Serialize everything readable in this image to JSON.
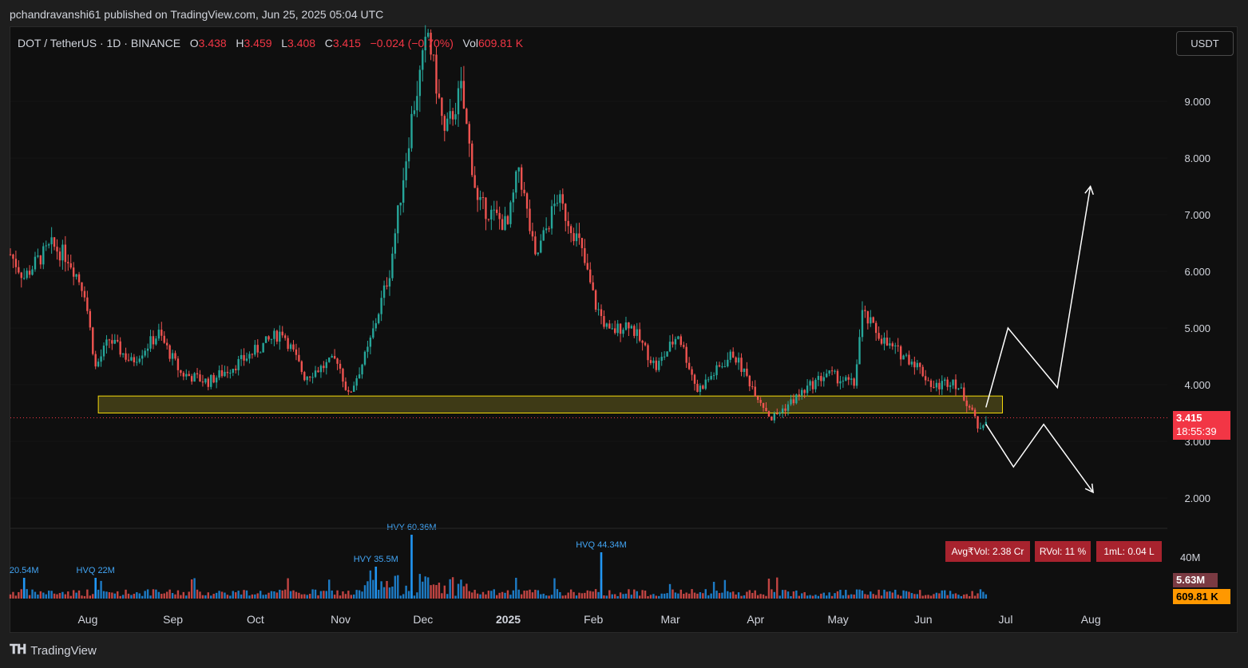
{
  "header": {
    "published": "pchandravanshi61 published on TradingView.com, Jun 25, 2025 05:04 UTC"
  },
  "legend": {
    "symbol": "DOT / TetherUS · 1D · BINANCE",
    "o_label": "O",
    "o": "3.438",
    "h_label": "H",
    "h": "3.459",
    "l_label": "L",
    "l": "3.408",
    "c_label": "C",
    "c": "3.415",
    "change": "−0.024 (−0.70%)",
    "vol_label": "Vol",
    "vol": "609.81 K"
  },
  "currency_button": "USDT",
  "price_tag": {
    "price": "3.415",
    "countdown": "18:55:39",
    "value": 3.415
  },
  "volume_tags": {
    "ma": "5.63M",
    "vol": "609.81 K",
    "scale": "40M"
  },
  "stats": {
    "avg": "Avg₹Vol: 2.38 Cr",
    "rvol": "RVol: 11 %",
    "ml": "1mL: 0.04 L"
  },
  "footer": {
    "brand": "TradingView"
  },
  "colors": {
    "up": "#26a69a",
    "down": "#ef5350",
    "zone": "#f5d90a",
    "tag": "#f23645",
    "vol_tag": "#ff9800"
  },
  "chart_data": {
    "type": "candlestick",
    "yaxis": {
      "ticks": [
        2,
        3,
        4,
        5,
        6,
        7,
        8,
        9
      ],
      "tick_labels": [
        "2.000",
        "3.000",
        "4.000",
        "5.000",
        "6.000",
        "7.000",
        "8.000",
        "9.000"
      ],
      "ylim": [
        1.5,
        10.3
      ]
    },
    "xaxis": {
      "labels": [
        "Aug",
        "Sep",
        "Oct",
        "Nov",
        "Dec",
        "2025",
        "Feb",
        "Mar",
        "Apr",
        "May",
        "Jun",
        "Jul",
        "Aug"
      ],
      "dates": [
        "2024-08-01",
        "2024-09-01",
        "2024-10-01",
        "2024-11-01",
        "2024-12-01",
        "2025-01-01",
        "2025-02-01",
        "2025-03-01",
        "2025-04-01",
        "2025-05-01",
        "2025-06-01",
        "2025-07-01",
        "2025-08-01"
      ],
      "range": [
        "2024-07-05",
        "2025-08-30"
      ]
    },
    "close_path": [
      [
        "2024-07-05",
        6.3
      ],
      [
        "2024-07-10",
        5.9
      ],
      [
        "2024-07-15",
        6.2
      ],
      [
        "2024-07-20",
        6.45
      ],
      [
        "2024-07-26",
        6.25
      ],
      [
        "2024-08-01",
        5.65
      ],
      [
        "2024-08-05",
        4.3
      ],
      [
        "2024-08-10",
        4.8
      ],
      [
        "2024-08-18",
        4.4
      ],
      [
        "2024-08-28",
        4.9
      ],
      [
        "2024-09-05",
        4.2
      ],
      [
        "2024-09-15",
        4.05
      ],
      [
        "2024-09-28",
        4.45
      ],
      [
        "2024-10-05",
        4.7
      ],
      [
        "2024-10-12",
        4.95
      ],
      [
        "2024-10-20",
        4.15
      ],
      [
        "2024-11-01",
        4.45
      ],
      [
        "2024-11-05",
        3.8
      ],
      [
        "2024-11-12",
        4.6
      ],
      [
        "2024-11-20",
        6.0
      ],
      [
        "2024-11-28",
        8.7
      ],
      [
        "2024-12-04",
        10.2
      ],
      [
        "2024-12-10",
        8.4
      ],
      [
        "2024-12-16",
        9.2
      ],
      [
        "2024-12-22",
        7.2
      ],
      [
        "2025-01-02",
        6.8
      ],
      [
        "2025-01-06",
        7.85
      ],
      [
        "2025-01-12",
        6.2
      ],
      [
        "2025-01-20",
        7.3
      ],
      [
        "2025-01-28",
        6.5
      ],
      [
        "2025-02-03",
        5.4
      ],
      [
        "2025-02-08",
        4.9
      ],
      [
        "2025-02-15",
        5.1
      ],
      [
        "2025-02-25",
        4.3
      ],
      [
        "2025-03-05",
        4.9
      ],
      [
        "2025-03-12",
        3.9
      ],
      [
        "2025-03-25",
        4.55
      ],
      [
        "2025-04-03",
        3.8
      ],
      [
        "2025-04-08",
        3.4
      ],
      [
        "2025-04-20",
        3.9
      ],
      [
        "2025-04-28",
        4.2
      ],
      [
        "2025-05-08",
        4.0
      ],
      [
        "2025-05-11",
        5.25
      ],
      [
        "2025-05-20",
        4.7
      ],
      [
        "2025-05-30",
        4.4
      ],
      [
        "2025-06-06",
        3.95
      ],
      [
        "2025-06-13",
        4.1
      ],
      [
        "2025-06-20",
        3.55
      ],
      [
        "2025-06-22",
        3.2
      ],
      [
        "2025-06-25",
        3.415
      ]
    ],
    "support_zone": {
      "from": "2024-08-06",
      "to": "2025-07-01",
      "low": 3.5,
      "high": 3.8
    },
    "projection_bull": [
      [
        "2025-06-25",
        3.6
      ],
      [
        "2025-07-03",
        5.0
      ],
      [
        "2025-07-21",
        3.95
      ],
      [
        "2025-08-02",
        7.5
      ]
    ],
    "projection_bear": [
      [
        "2025-06-25",
        3.3
      ],
      [
        "2025-07-05",
        2.55
      ],
      [
        "2025-07-16",
        3.3
      ],
      [
        "2025-08-03",
        2.1
      ]
    ],
    "volume_markers": [
      {
        "label": "20.54M",
        "date": "2024-07-10"
      },
      {
        "label": "HVQ 22M",
        "date": "2024-08-05"
      },
      {
        "label": "HVY 35.5M",
        "date": "2024-11-15"
      },
      {
        "label": "HVY 60.36M",
        "date": "2024-11-28"
      },
      {
        "label": "HVQ 44.34M",
        "date": "2025-02-05"
      }
    ]
  }
}
